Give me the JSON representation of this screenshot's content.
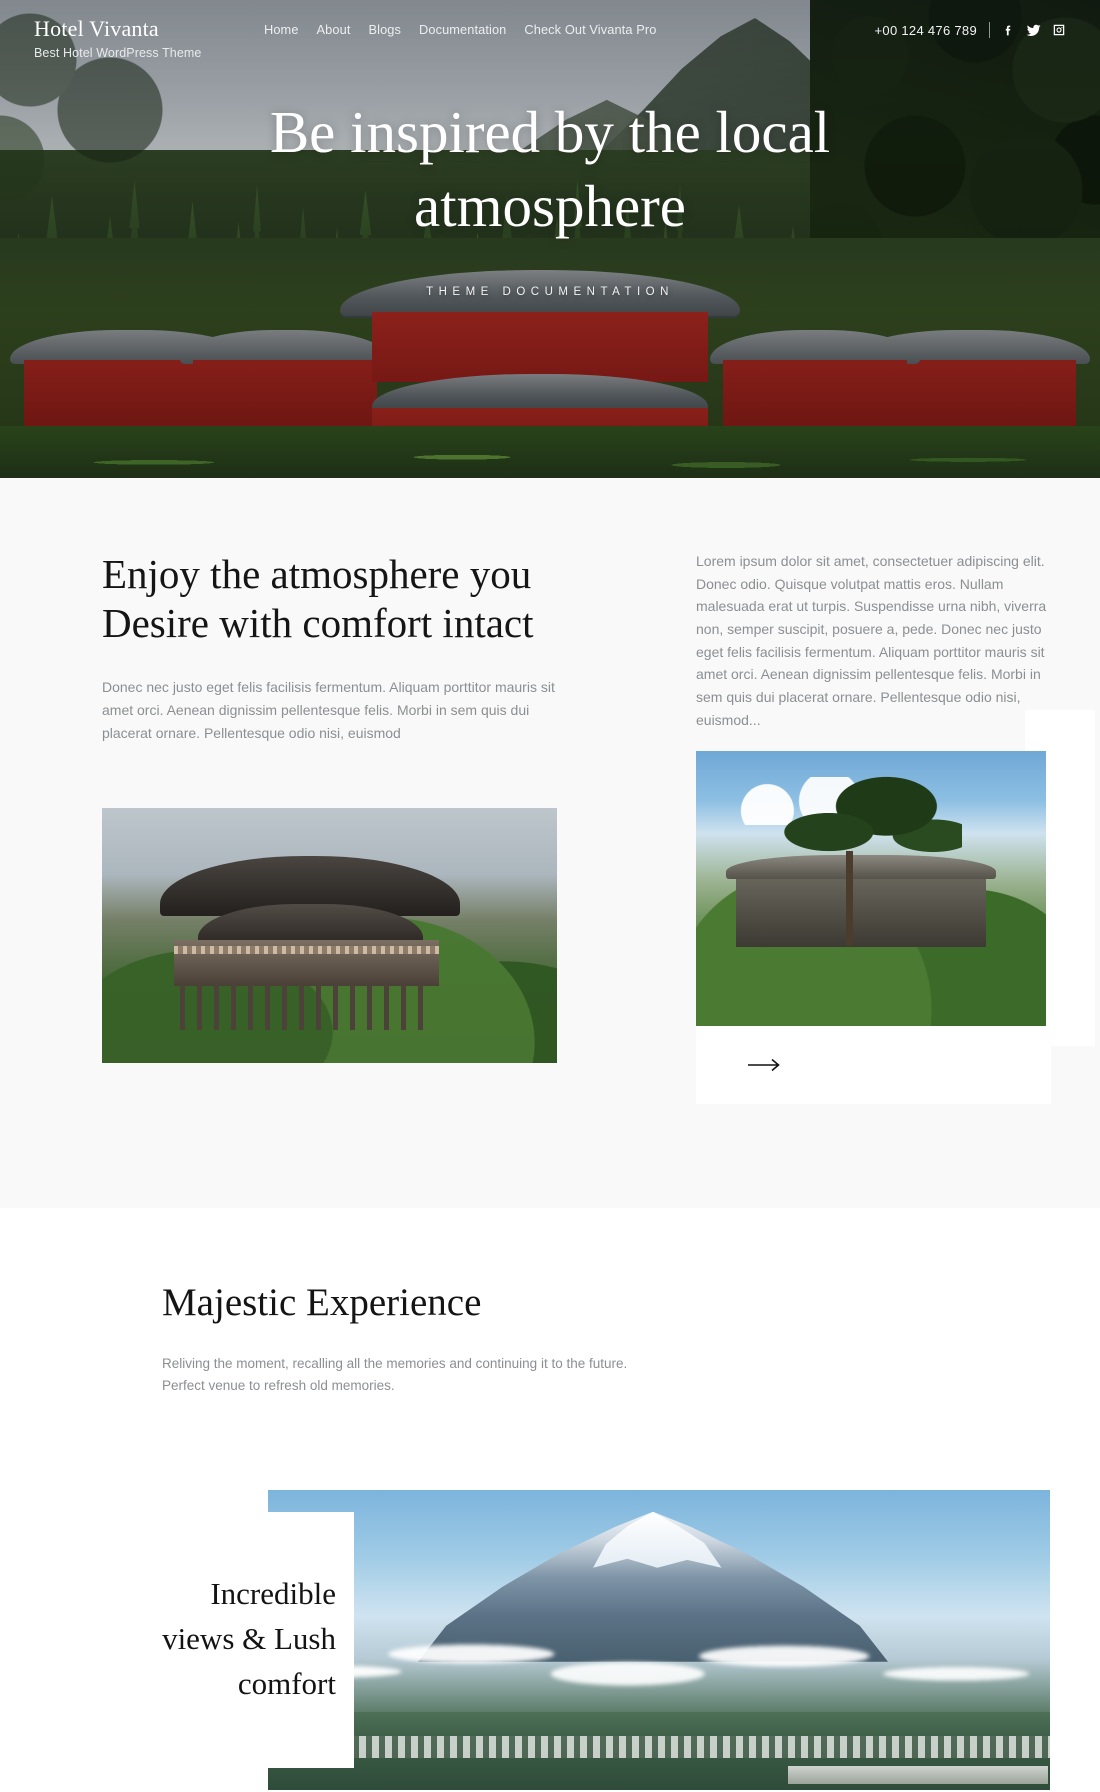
{
  "header": {
    "brand_title": "Hotel Vivanta",
    "brand_subtitle": "Best Hotel WordPress Theme",
    "nav": [
      {
        "label": "Home"
      },
      {
        "label": "About"
      },
      {
        "label": "Blogs"
      },
      {
        "label": "Documentation"
      },
      {
        "label": "Check Out Vivanta Pro"
      }
    ],
    "phone": "+00 124 476 789",
    "socials": [
      {
        "name": "facebook-icon"
      },
      {
        "name": "twitter-icon"
      },
      {
        "name": "instagram-icon"
      }
    ]
  },
  "hero": {
    "title": "Be inspired by the local atmosphere",
    "subtitle": "THEME DOCUMENTATION"
  },
  "enjoy": {
    "heading": "Enjoy the atmosphere you Desire with comfort intact",
    "left_paragraph": "Donec nec justo eget felis facilisis fermentum. Aliquam porttitor mauris sit amet orci. Aenean dignissim pellentesque felis. Morbi in sem quis dui placerat ornare. Pellentesque odio nisi, euismod",
    "right_paragraph": "Lorem ipsum dolor sit amet, consectetuer adipiscing elit. Donec odio. Quisque volutpat mattis eros. Nullam malesuada erat ut turpis. Suspendisse urna nibh, viverra non, semper suscipit, posuere a, pede. Donec nec justo eget felis facilisis fermentum. Aliquam porttitor mauris sit amet orci. Aenean dignissim pellentesque felis. Morbi in sem quis dui placerat ornare. Pellentesque odio nisi, euismod...",
    "arrow_label": "→"
  },
  "majestic": {
    "heading": "Majestic Experience",
    "paragraph": "Reliving the moment, recalling all the memories and continuing it to the future. Perfect venue to refresh old memories.",
    "card_text": "Incredible views & Lush comfort"
  },
  "colors": {
    "section_bg": "#f9f9f9",
    "page_bg": "#ffffff",
    "body_text": "#8c8f92",
    "heading_text": "#141414",
    "header_text": "#ffffff"
  }
}
